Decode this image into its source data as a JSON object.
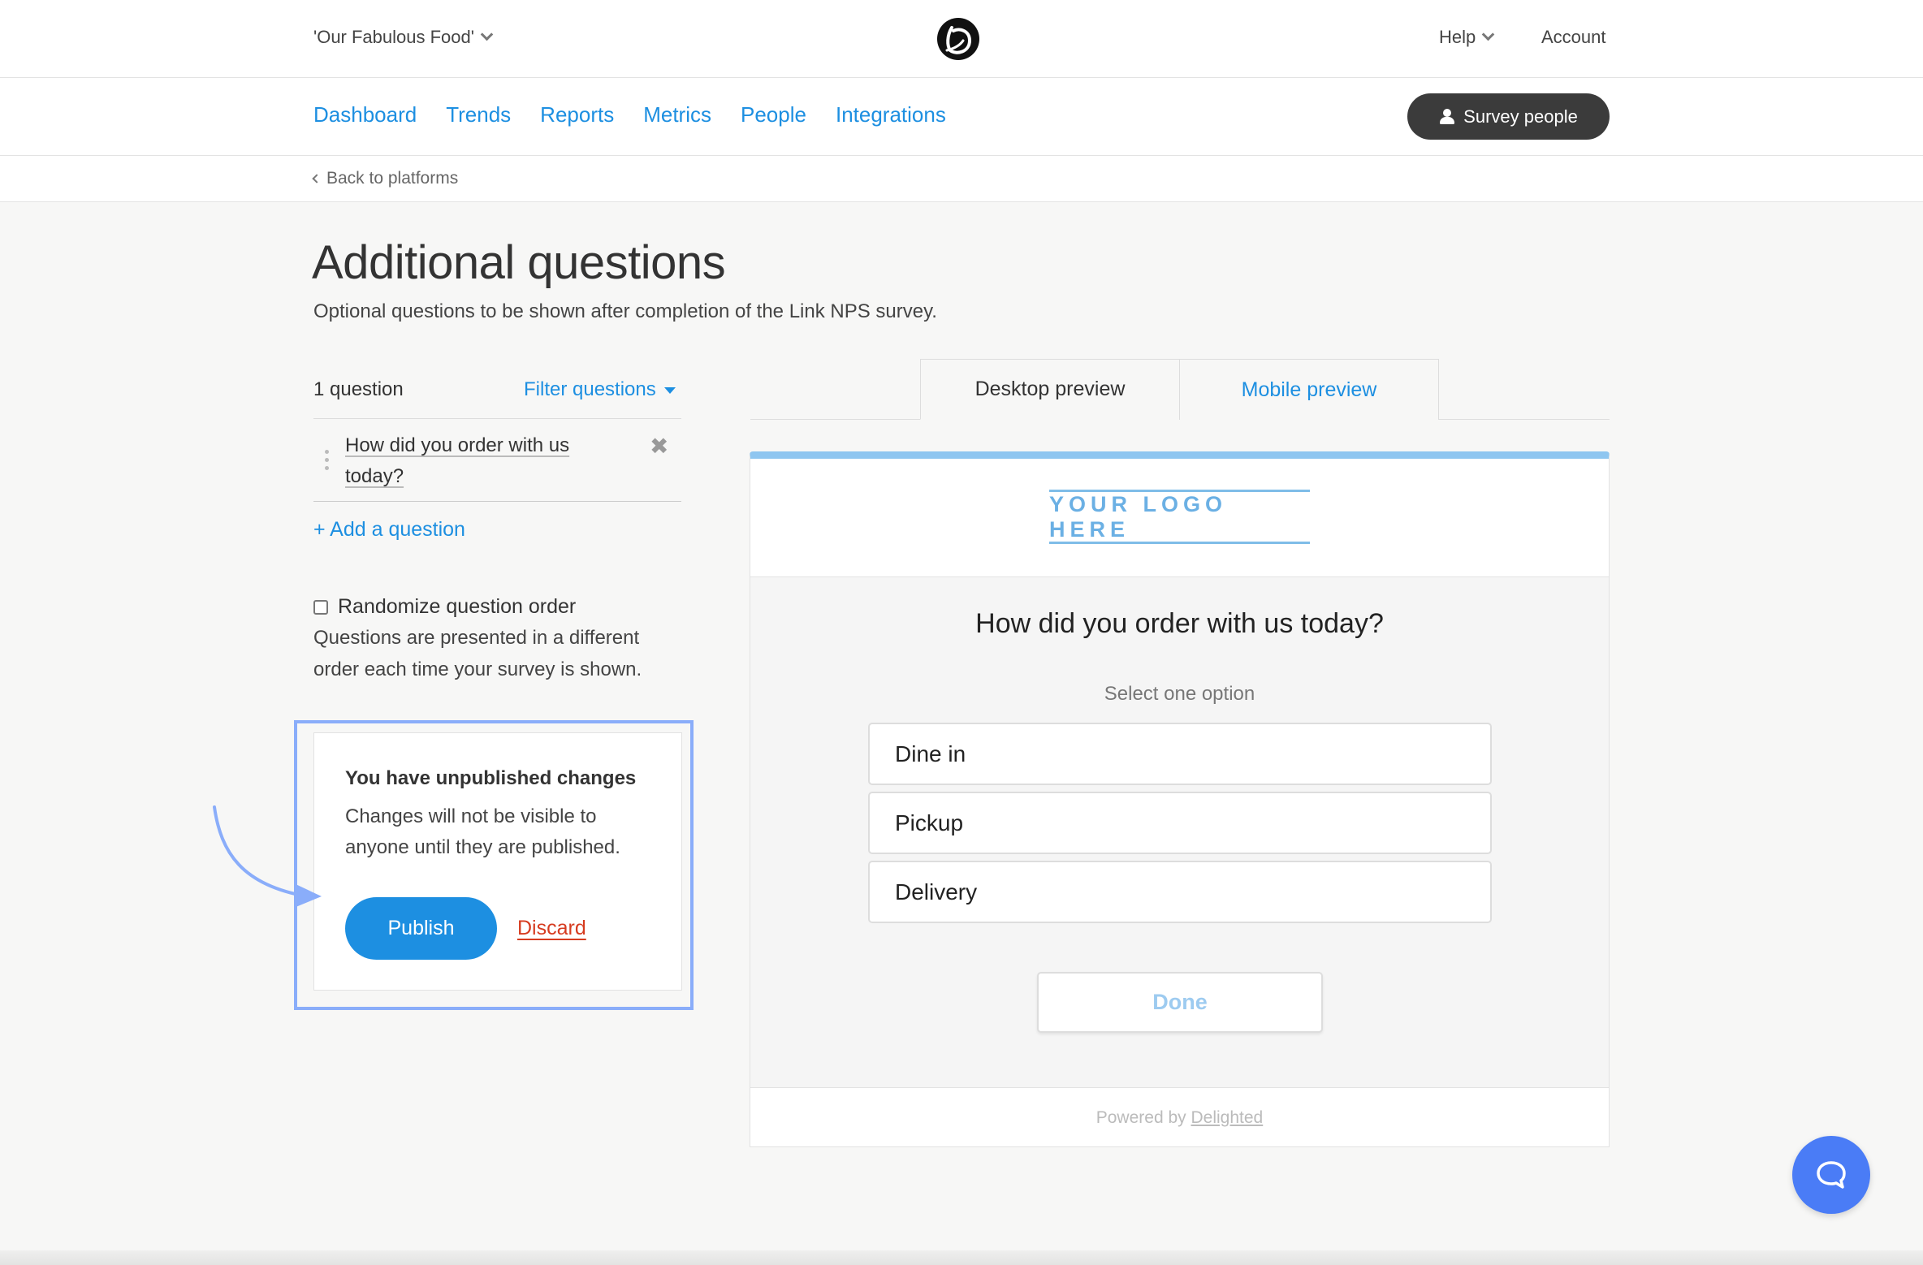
{
  "header": {
    "project_name": "'Our Fabulous Food'",
    "help_label": "Help",
    "account_label": "Account"
  },
  "nav": {
    "items": [
      {
        "label": "Dashboard"
      },
      {
        "label": "Trends"
      },
      {
        "label": "Reports"
      },
      {
        "label": "Metrics"
      },
      {
        "label": "People"
      },
      {
        "label": "Integrations"
      }
    ],
    "survey_button": "Survey people"
  },
  "breadcrumb": {
    "back_label": "Back to platforms"
  },
  "page": {
    "title": "Additional questions",
    "subtitle": "Optional questions to be shown after completion of the Link NPS survey."
  },
  "questions": {
    "count_label": "1 question",
    "filter_label": "Filter questions",
    "items": [
      {
        "text": "How did you order with us today?"
      }
    ],
    "add_label": "+ Add a question",
    "randomize_label": "Randomize question order",
    "randomize_checked": false,
    "randomize_desc": "Questions are presented in a different order each time your survey is shown."
  },
  "unpublished": {
    "title": "You have unpublished changes",
    "body": "Changes will not be visible to anyone until they are published.",
    "publish_label": "Publish",
    "discard_label": "Discard"
  },
  "preview": {
    "tabs": [
      {
        "label": "Desktop preview",
        "active": true
      },
      {
        "label": "Mobile preview",
        "active": false
      }
    ],
    "logo_placeholder": "YOUR LOGO HERE",
    "question": "How did you order with us today?",
    "hint": "Select one option",
    "options": [
      {
        "label": "Dine in"
      },
      {
        "label": "Pickup"
      },
      {
        "label": "Delivery"
      }
    ],
    "done_label": "Done",
    "powered_prefix": "Powered by",
    "powered_link": "Delighted"
  },
  "colors": {
    "link_blue": "#1d8fe1",
    "dark_button": "#3b3b3b",
    "highlight_border": "#8aadfa",
    "discard_red": "#d63b1f",
    "chat_blue": "#4a7cf6"
  },
  "icons": {
    "project_dropdown": "chevron-down-icon",
    "logo": "delighted-logo-icon",
    "help_dropdown": "chevron-down-icon",
    "survey_button": "person-icon",
    "back": "chevron-left-icon",
    "filter": "caret-down-icon",
    "drag": "drag-handle-icon",
    "remove": "close-icon",
    "chat": "chat-bubble-icon"
  }
}
